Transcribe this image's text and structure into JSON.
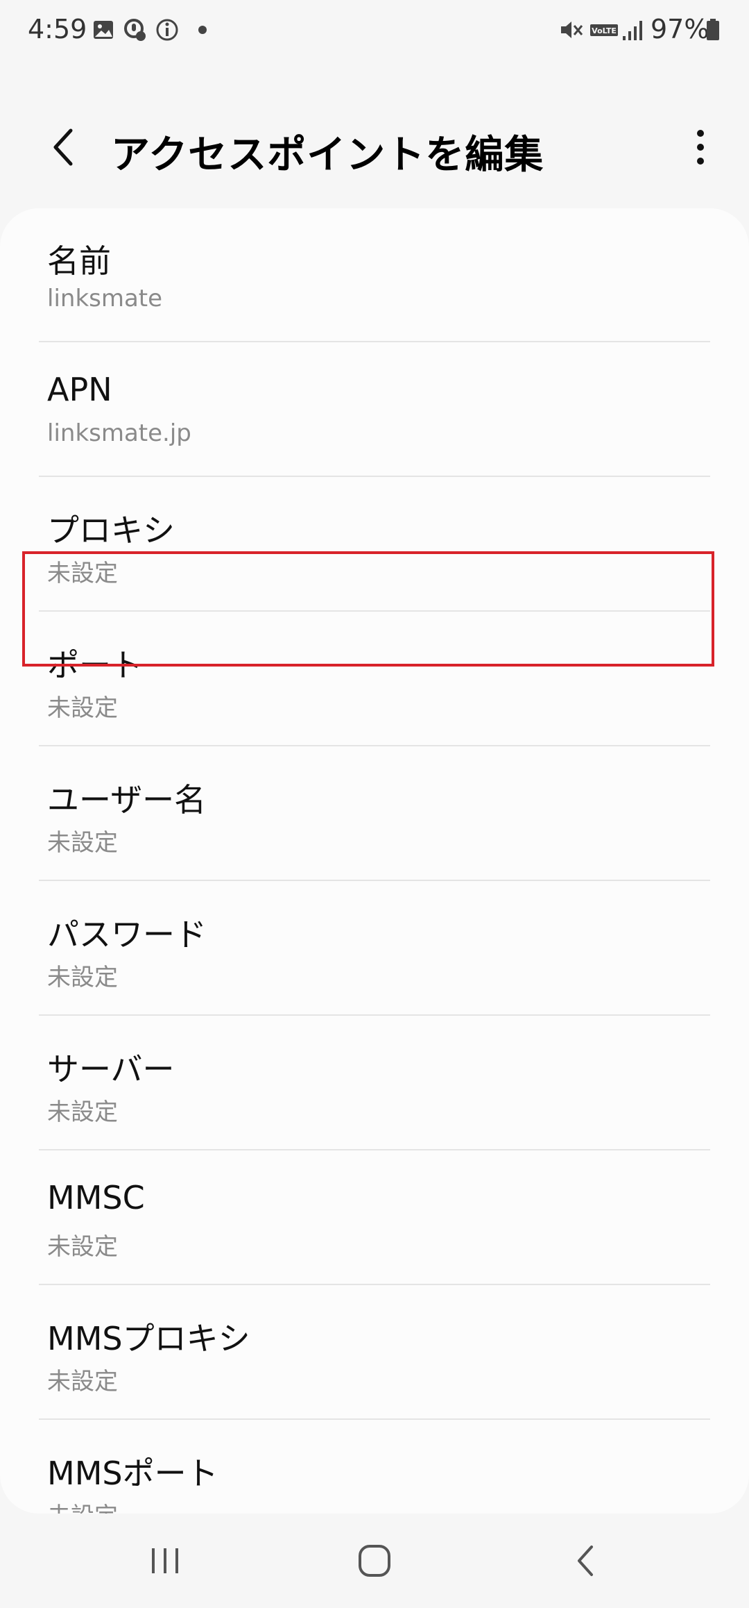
{
  "status_bar": {
    "time": "4:59",
    "battery_percent": "97%",
    "left_icons": [
      "gallery-icon",
      "mic-off-badge-icon",
      "info-icon",
      "dot-icon"
    ],
    "right_icons": [
      "mute-icon",
      "volte-icon",
      "signal-icon",
      "battery-icon"
    ],
    "volte_label": "VoLTE"
  },
  "app_bar": {
    "title": "アクセスポイントを編集",
    "back_icon": "back-chevron-icon",
    "more_icon": "more-vert-icon"
  },
  "settings": [
    {
      "title": "名前",
      "value": "linksmate"
    },
    {
      "title": "APN",
      "value": "linksmate.jp"
    },
    {
      "title": "プロキシ",
      "value": "未設定"
    },
    {
      "title": "ポート",
      "value": "未設定"
    },
    {
      "title": "ユーザー名",
      "value": "未設定"
    },
    {
      "title": "パスワード",
      "value": "未設定"
    },
    {
      "title": "サーバー",
      "value": "未設定"
    },
    {
      "title": "MMSC",
      "value": "未設定"
    },
    {
      "title": "MMSプロキシ",
      "value": "未設定"
    },
    {
      "title": "MMSポート",
      "value": "未設定"
    }
  ],
  "highlight_color": "#d8232a",
  "nav_bar": {
    "buttons": [
      "recents-icon",
      "home-icon",
      "back-icon"
    ]
  }
}
